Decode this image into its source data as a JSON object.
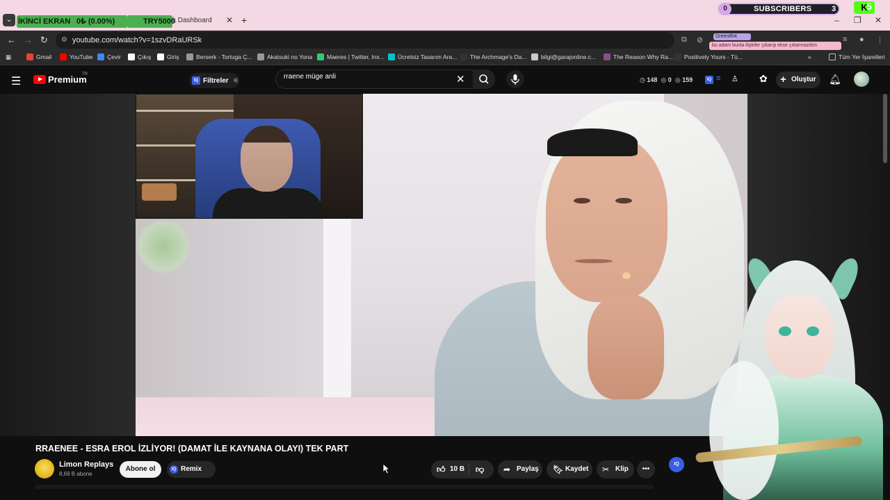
{
  "browser": {
    "overlay_label": "İKİNCİ EKRAN",
    "overlay_progress": "0₺ (0.00%)",
    "overlay_goal": "TRY5000",
    "tab_title": "k Dashboard",
    "url": "youtube.com/watch?v=1szvDRaURSk",
    "bookmarks": [
      {
        "label": "Gmail",
        "color": "#ea4335"
      },
      {
        "label": "YouTube",
        "color": "#ff0000"
      },
      {
        "label": "Çevir",
        "color": "#4285f4"
      },
      {
        "label": "Çıkış",
        "color": "#ffffff"
      },
      {
        "label": "Giriş",
        "color": "#ffffff"
      },
      {
        "label": "Berserk - Tortuga Ç...",
        "color": "#999999"
      },
      {
        "label": "Akatsuki no Yona",
        "color": "#999999"
      },
      {
        "label": "Maeres | Twitter, Ins...",
        "color": "#2ecc71"
      },
      {
        "label": "Ücretsiz Tasarım Ara...",
        "color": "#00c4cc"
      },
      {
        "label": "The Archmage's Da...",
        "color": "#333333"
      },
      {
        "label": "bilgi@garajonline.c...",
        "color": "#cccccc"
      },
      {
        "label": "The Reason Why Ra...",
        "color": "#8a4f8a"
      },
      {
        "label": "Positively Yours - Tü...",
        "color": "#333333"
      }
    ],
    "all_bookmarks": "Tüm Yer İşaretleri"
  },
  "stream_overlay": {
    "subs_left": "0",
    "subs_label": "SUBSCRIBERS",
    "subs_right": "3",
    "kick_count": "5",
    "chat_name": "Ωreen8h4",
    "chat_msg": "bu adam bunla ilişkiler çıkarıp ekse çıkarmazdım"
  },
  "youtube": {
    "logo": "Premium",
    "region": "TR",
    "filters_label": "Filtreler",
    "search_value": "rraene müge anli",
    "stats": {
      "views": "148",
      "zero": "0",
      "likes": "159"
    },
    "create_label": "Oluştur"
  },
  "video": {
    "title": "RRAENEE - ESRA EROL İZLİYOR! (DAMAT İLE KAYNANA OLAYI) TEK PART",
    "channel": "Limon Replays",
    "subscribers": "8,69 B abone",
    "subscribe_label": "Abone ol",
    "remix_label": "Remix",
    "likes": "10 B",
    "share_label": "Paylaş",
    "save_label": "Kaydet",
    "clip_label": "Klip"
  }
}
